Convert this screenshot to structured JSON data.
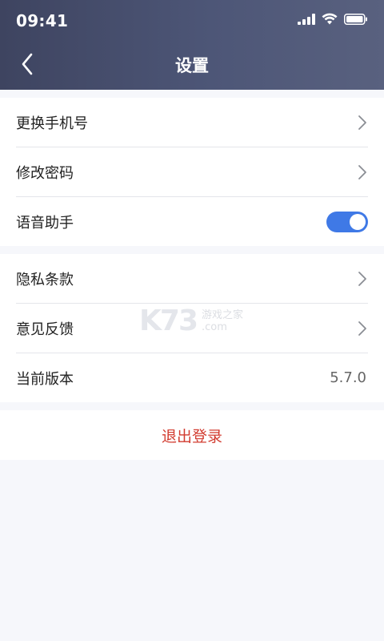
{
  "status_bar": {
    "time": "09:41"
  },
  "nav": {
    "title": "设置"
  },
  "groups": [
    {
      "rows": [
        {
          "label": "更换手机号",
          "type": "chevron"
        },
        {
          "label": "修改密码",
          "type": "chevron"
        },
        {
          "label": "语音助手",
          "type": "toggle",
          "enabled": true
        }
      ]
    },
    {
      "rows": [
        {
          "label": "隐私条款",
          "type": "chevron"
        },
        {
          "label": "意见反馈",
          "type": "chevron"
        },
        {
          "label": "当前版本",
          "type": "value",
          "value": "5.7.0"
        }
      ]
    }
  ],
  "logout": {
    "label": "退出登录"
  },
  "watermark": {
    "logo": "K73",
    "line1": "游戏之家",
    "line2": ".com"
  },
  "colors": {
    "header_start": "#3e4460",
    "header_end": "#59617f",
    "toggle_on": "#3f79e6",
    "logout_text": "#d23c30"
  },
  "icons": {
    "back": "chevron-left-icon",
    "row_arrow": "chevron-right-icon",
    "signal": "signal-bars-icon",
    "wifi": "wifi-icon",
    "battery": "battery-icon"
  }
}
